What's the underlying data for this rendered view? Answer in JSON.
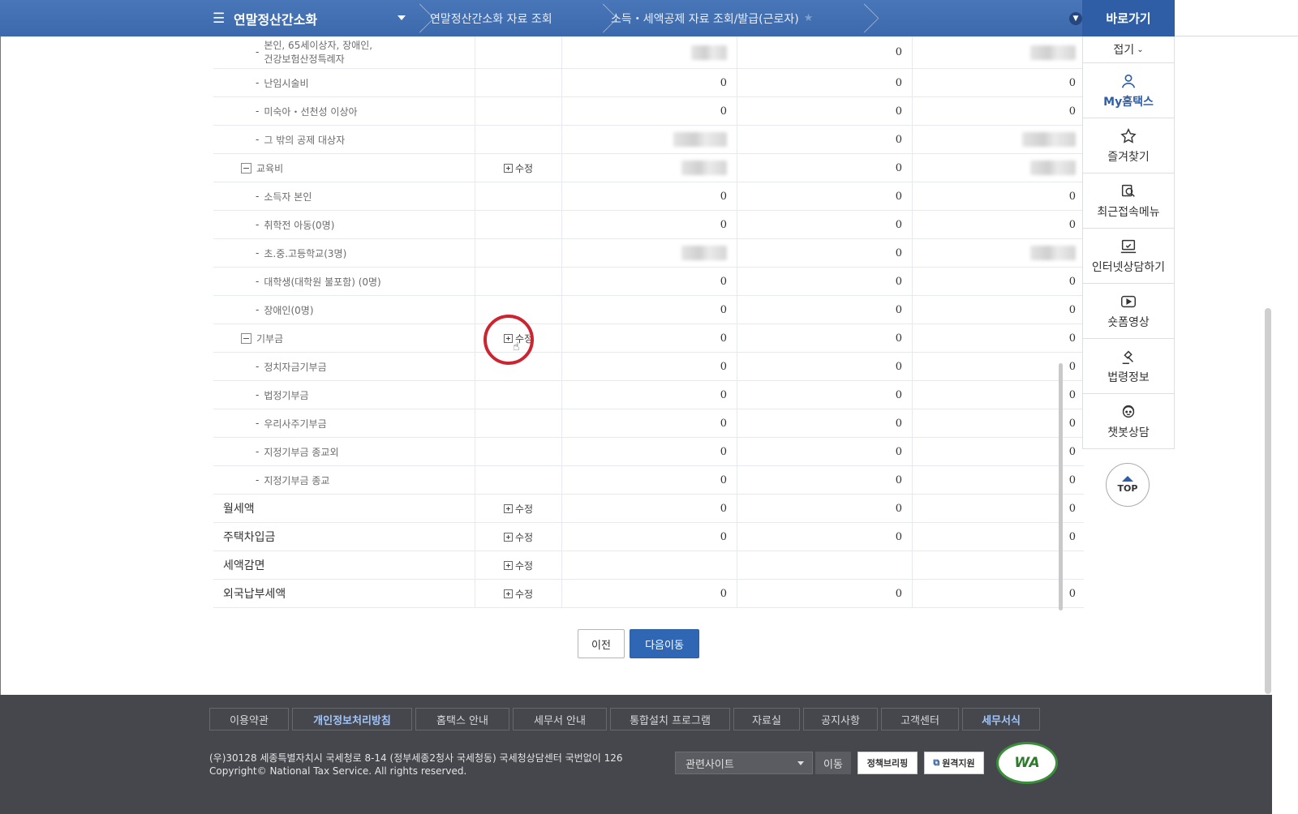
{
  "breadcrumb": {
    "root": "연말정산간소화",
    "item1": "연말정산간소화 자료 조회",
    "item2": "소득・세액공제 자료 조회/발급(근로자)"
  },
  "quick_panel": {
    "title": "바로가기",
    "fold_label": "접기",
    "items": [
      {
        "label": "My홈택스",
        "icon": "user-icon"
      },
      {
        "label": "즐겨찾기",
        "icon": "star-icon"
      },
      {
        "label": "최근접속메뉴",
        "icon": "recent-search-icon"
      },
      {
        "label": "인터넷상담하기",
        "icon": "monitor-consult-icon"
      },
      {
        "label": "숏폼영상",
        "icon": "video-play-icon"
      },
      {
        "label": "법령정보",
        "icon": "gavel-icon"
      },
      {
        "label": "챗봇상담",
        "icon": "chatbot-icon"
      }
    ],
    "top_label": "TOP"
  },
  "table": {
    "edit_label": "수정",
    "rows": [
      {
        "label": "본인, 65세이상자, 장애인,",
        "label2": "건강보험산정특례자",
        "level": 2,
        "edit": false,
        "v1": "",
        "v2": "0",
        "v3": ""
      },
      {
        "label": "난임시술비",
        "level": 2,
        "edit": false,
        "v1": "0",
        "v2": "0",
        "v3": "0"
      },
      {
        "label": "미숙아・선천성 이상아",
        "level": 2,
        "edit": false,
        "v1": "0",
        "v2": "0",
        "v3": "0"
      },
      {
        "label": "그 밖의 공제 대상자",
        "level": 2,
        "edit": false,
        "v1": "",
        "v2": "0",
        "v3": ""
      },
      {
        "label": "교육비",
        "level": 1,
        "edit": true,
        "v1": "",
        "v2": "0",
        "v3": ""
      },
      {
        "label": "소득자 본인",
        "level": 2,
        "edit": false,
        "v1": "0",
        "v2": "0",
        "v3": "0"
      },
      {
        "label": "취학전 아동(0명)",
        "level": 2,
        "edit": false,
        "v1": "0",
        "v2": "0",
        "v3": "0"
      },
      {
        "label": "초.중.고등학교(3명)",
        "level": 2,
        "edit": false,
        "v1": "",
        "v2": "0",
        "v3": ""
      },
      {
        "label": "대학생(대학원 불포함) (0명)",
        "level": 2,
        "edit": false,
        "v1": "0",
        "v2": "0",
        "v3": "0"
      },
      {
        "label": "장애인(0명)",
        "level": 2,
        "edit": false,
        "v1": "0",
        "v2": "0",
        "v3": "0"
      },
      {
        "label": "기부금",
        "level": 1,
        "edit": true,
        "v1": "0",
        "v2": "0",
        "v3": "0"
      },
      {
        "label": "정치자금기부금",
        "level": 2,
        "edit": false,
        "v1": "0",
        "v2": "0",
        "v3": "0"
      },
      {
        "label": "법정기부금",
        "level": 2,
        "edit": false,
        "v1": "0",
        "v2": "0",
        "v3": "0"
      },
      {
        "label": "우리사주기부금",
        "level": 2,
        "edit": false,
        "v1": "0",
        "v2": "0",
        "v3": "0"
      },
      {
        "label": "지정기부금 종교외",
        "level": 2,
        "edit": false,
        "v1": "0",
        "v2": "0",
        "v3": "0"
      },
      {
        "label": "지정기부금 종교",
        "level": 2,
        "edit": false,
        "v1": "0",
        "v2": "0",
        "v3": "0"
      },
      {
        "label": "월세액",
        "level": 0,
        "edit": true,
        "v1": "0",
        "v2": "0",
        "v3": "0"
      },
      {
        "label": "주택차입금",
        "level": 0,
        "edit": true,
        "v1": "0",
        "v2": "0",
        "v3": "0"
      },
      {
        "label": "세액감면",
        "level": 0,
        "edit": true,
        "v1": "",
        "v2": "",
        "v3": ""
      },
      {
        "label": "외국납부세액",
        "level": 0,
        "edit": true,
        "v1": "0",
        "v2": "0",
        "v3": "0"
      }
    ]
  },
  "buttons": {
    "prev": "이전",
    "next": "다음이동"
  },
  "footer": {
    "links": [
      "이용약관",
      "개인정보처리방침",
      "홈택스 안내",
      "세무서 안내",
      "통합설치 프로그램",
      "자료실",
      "공지사항",
      "고객센터",
      "세무서식"
    ],
    "address": "(우)30128 세종특별자치시 국세청로 8-14 (정부세종2청사 국세청동) 국세청상담센터 국번없이 126",
    "copyright": "Copyright© National Tax Service. All rights reserved.",
    "related_site": "관련사이트",
    "go": "이동",
    "policy_briefing": "정책브리핑",
    "remote_support": "원격지원",
    "wa_mark": "WA"
  }
}
